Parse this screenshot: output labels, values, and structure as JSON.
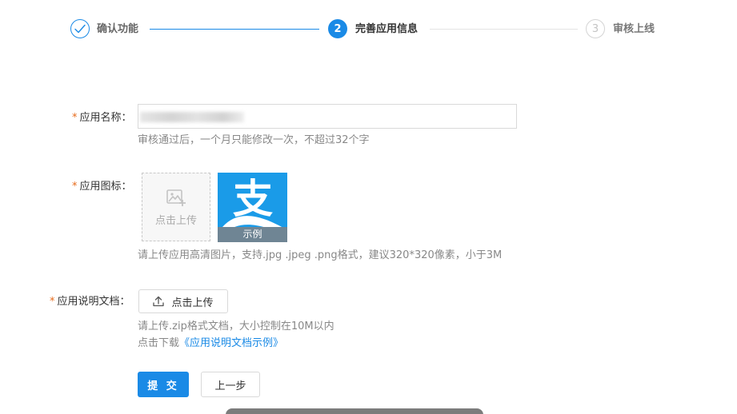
{
  "steps": [
    {
      "label": "确认功能",
      "status": "done"
    },
    {
      "label": "完善应用信息",
      "number": "2",
      "status": "active"
    },
    {
      "label": "审核上线",
      "number": "3",
      "status": "todo"
    }
  ],
  "form": {
    "required_mark": "*",
    "app_name": {
      "label": "应用名称：",
      "hint": "审核通过后，一个月只能修改一次，不超过32个字"
    },
    "app_icon": {
      "label": "应用图标：",
      "upload_text": "点击上传",
      "example_caption": "示例",
      "example_glyph": "支",
      "hint": "请上传应用高清图片，支持.jpg .jpeg .png格式，建议320*320像素，小于3M"
    },
    "app_doc": {
      "label": "应用说明文档：",
      "upload_button": "点击上传",
      "hint": "请上传.zip格式文档，大小控制在10M以内",
      "download_prefix": "点击下载",
      "download_link": "《应用说明文档示例》"
    }
  },
  "actions": {
    "submit": "提 交",
    "prev": "上一步"
  },
  "colors": {
    "accent": "#1a8ae6",
    "required": "#e66a1a",
    "example_bg": "#1a9be8"
  },
  "icons": [
    "check-icon",
    "image-add-icon",
    "upload-icon"
  ]
}
